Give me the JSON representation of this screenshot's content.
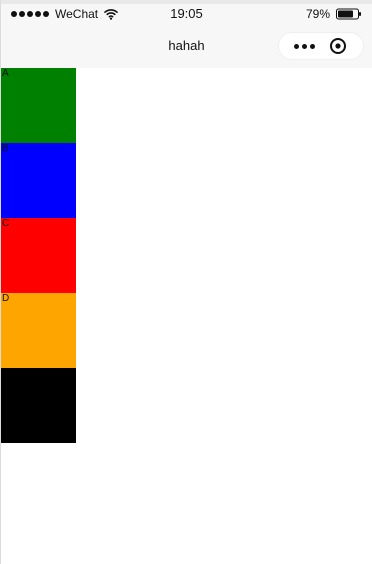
{
  "status_bar": {
    "carrier": "WeChat",
    "time": "19:05",
    "battery_percent": "79%",
    "battery_level": 0.79,
    "icons": {
      "signal": "signal-dots-icon",
      "wifi": "wifi-icon",
      "battery": "battery-icon"
    }
  },
  "nav": {
    "title": "hahah",
    "capsule": {
      "more_icon": "more-icon",
      "target_icon": "target-icon"
    }
  },
  "content": {
    "blocks": [
      {
        "label": "A",
        "color": "#008000"
      },
      {
        "label": "B",
        "color": "#0000ff"
      },
      {
        "label": "C",
        "color": "#ff0000"
      },
      {
        "label": "D",
        "color": "#ffa500"
      },
      {
        "label": "",
        "color": "#000000"
      }
    ]
  }
}
